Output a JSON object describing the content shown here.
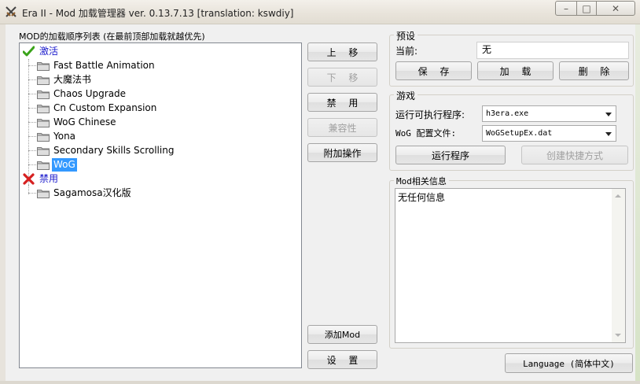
{
  "window": {
    "title": "Era II - Mod 加载管理器 ver. 0.13.7.13 [translation: kswdiy]",
    "controls": {
      "minimize": "–",
      "maximize": "□",
      "close": "✕"
    }
  },
  "mod_list": {
    "label": "MOD的加载顺序列表 (在最前顶部加载就越优先)",
    "enabled_label": "激活",
    "disabled_label": "禁用",
    "enabled_mods": [
      "Fast Battle Animation",
      "大魔法书",
      "Chaos Upgrade",
      "Cn Custom Expansion",
      "WoG Chinese",
      "Yona",
      "Secondary Skills Scrolling",
      "WoG"
    ],
    "selected_mod": "WoG",
    "disabled_mods": [
      "Sagamosa汉化版"
    ]
  },
  "actions": {
    "move_up": "上 移",
    "move_down": "下 移",
    "disable": "禁 用",
    "compatibility": "兼容性",
    "extra": "附加操作",
    "add_mod": "添加Mod",
    "settings": "设 置"
  },
  "preset": {
    "title": "预设",
    "current_label": "当前:",
    "current_value": "无",
    "save": "保 存",
    "load": "加 载",
    "delete": "删 除"
  },
  "game": {
    "title": "游戏",
    "exe_label": "运行可执行程序:",
    "exe_value": "h3era.exe",
    "config_label": "WoG 配置文件:",
    "config_value": "WoGSetupEx.dat",
    "run": "运行程序",
    "shortcut": "创建快捷方式"
  },
  "info": {
    "title": "Mod相关信息",
    "text": "无任何信息"
  },
  "language_button": "Language (简体中文)",
  "colors": {
    "enabled_label": "#1a1acc",
    "selection": "#3399ff",
    "check": "#3aa31a",
    "cross": "#d62020"
  }
}
